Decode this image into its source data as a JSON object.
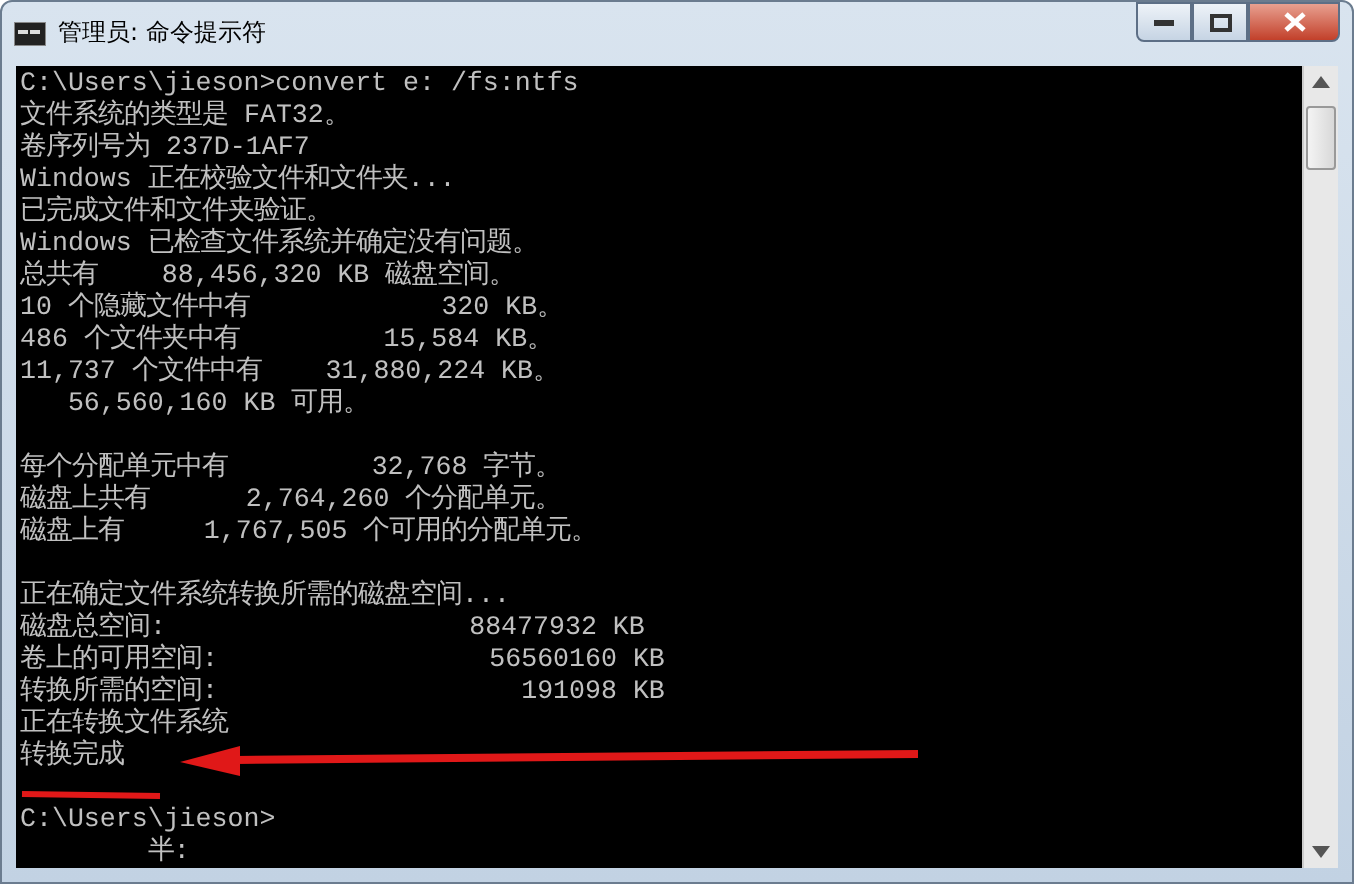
{
  "window": {
    "title": "管理员: 命令提示符"
  },
  "console": {
    "lines": [
      {
        "kind": "text",
        "text": "C:\\Users\\jieson>convert e: /fs:ntfs"
      },
      {
        "kind": "text",
        "text": "文件系统的类型是 FAT32。"
      },
      {
        "kind": "text",
        "text": "卷序列号为 237D-1AF7"
      },
      {
        "kind": "text",
        "text": "Windows 正在校验文件和文件夹..."
      },
      {
        "kind": "text",
        "text": "已完成文件和文件夹验证。"
      },
      {
        "kind": "text",
        "text": "Windows 已检查文件系统并确定没有问题。"
      },
      {
        "kind": "text",
        "text": "总共有    88,456,320 KB 磁盘空间。"
      },
      {
        "kind": "text",
        "text": "10 个隐藏文件中有            320 KB。"
      },
      {
        "kind": "text",
        "text": "486 个文件夹中有         15,584 KB。"
      },
      {
        "kind": "text",
        "text": "11,737 个文件中有    31,880,224 KB。"
      },
      {
        "kind": "text",
        "text": "   56,560,160 KB 可用。"
      },
      {
        "kind": "blank"
      },
      {
        "kind": "text",
        "text": "每个分配单元中有         32,768 字节。"
      },
      {
        "kind": "text",
        "text": "磁盘上共有      2,764,260 个分配单元。"
      },
      {
        "kind": "text",
        "text": "磁盘上有     1,767,505 个可用的分配单元。"
      },
      {
        "kind": "blank"
      },
      {
        "kind": "text",
        "text": "正在确定文件系统转换所需的磁盘空间..."
      },
      {
        "kind": "text",
        "text": "磁盘总空间:                   88477932 KB"
      },
      {
        "kind": "text",
        "text": "卷上的可用空间:                 56560160 KB"
      },
      {
        "kind": "text",
        "text": "转换所需的空间:                   191098 KB"
      },
      {
        "kind": "text",
        "text": "正在转换文件系统"
      },
      {
        "kind": "text",
        "text": "转换完成"
      },
      {
        "kind": "blank"
      },
      {
        "kind": "text",
        "text": "C:\\Users\\jieson>"
      },
      {
        "kind": "text",
        "text": "        半:"
      }
    ]
  },
  "markup": {
    "arrow": true,
    "underline": true
  }
}
